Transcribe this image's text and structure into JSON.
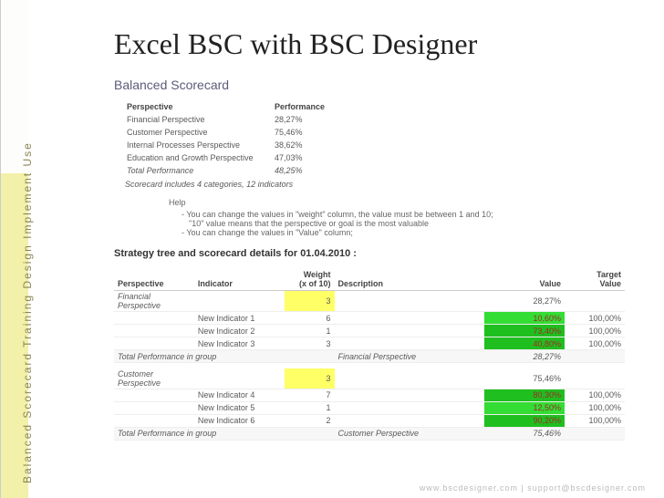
{
  "sidebar": {
    "full_text": "Balanced Scorecard Training   Design   Implement   Use"
  },
  "title": "Excel BSC with BSC Designer",
  "section_title": "Balanced Scorecard",
  "perf": {
    "hdr_perspective": "Perspective",
    "hdr_performance": "Performance",
    "rows": [
      {
        "label": "Financial Perspective",
        "value": "28,27%"
      },
      {
        "label": "Customer Perspective",
        "value": "75,46%"
      },
      {
        "label": "Internal Processes Perspective",
        "value": "38,62%"
      },
      {
        "label": "Education and Growth Perspective",
        "value": "47,03%"
      }
    ],
    "total_label": "Total Performance",
    "total_value": "48,25%",
    "summary": "Scorecard includes 4 categories, 12 indicators"
  },
  "help": {
    "title": "Help",
    "lines": [
      "You can change the values in \"weight\" column, the value must be between 1 and 10;",
      "\"10\" value means that the perspective or goal is the most valuable",
      "You can change the values in \"Value\" column;"
    ]
  },
  "strategy_heading": "Strategy tree and scorecard details for 01.04.2010 :",
  "details": {
    "headers": {
      "perspective": "Perspective",
      "indicator": "Indicator",
      "weight": "Weight (x of 10)",
      "weight_l1": "Weight",
      "weight_l2": "(x of 10)",
      "description": "Description",
      "value": "Value",
      "target": "Target Value",
      "target_l1": "Target",
      "target_l2": "Value"
    },
    "groups": [
      {
        "name": "Financial Perspective",
        "name_italic": true,
        "group_weight": "3",
        "group_weight_hl": "yellow",
        "group_value": "28,27%",
        "rows": [
          {
            "indicator": "New Indicator 1",
            "weight": "6",
            "value": "10,60%",
            "value_hl": "green",
            "target": "100,00%"
          },
          {
            "indicator": "New Indicator 2",
            "weight": "1",
            "value": "73,40%",
            "value_hl": "green2",
            "target": "100,00%"
          },
          {
            "indicator": "New Indicator 3",
            "weight": "3",
            "value": "40,80%",
            "value_hl": "green2",
            "target": "100,00%"
          }
        ],
        "total_label": "Total Performance in group",
        "total_desc": "Financial Perspective",
        "total_value": "28,27%"
      },
      {
        "name": "Customer Perspective",
        "name_italic": true,
        "group_weight": "3",
        "group_weight_hl": "yellow",
        "group_value": "75,46%",
        "rows": [
          {
            "indicator": "New Indicator 4",
            "weight": "7",
            "value": "80,30%",
            "value_hl": "green2",
            "target": "100,00%"
          },
          {
            "indicator": "New Indicator 5",
            "weight": "1",
            "value": "12,50%",
            "value_hl": "green",
            "target": "100,00%"
          },
          {
            "indicator": "New Indicator 6",
            "weight": "2",
            "value": "90,20%",
            "value_hl": "green2",
            "target": "100,00%"
          }
        ],
        "total_label": "Total Performance in group",
        "total_desc": "Customer Perspective",
        "total_value": "75,46%"
      }
    ]
  },
  "footer": "www.bscdesigner.com | support@bscdesigner.com"
}
